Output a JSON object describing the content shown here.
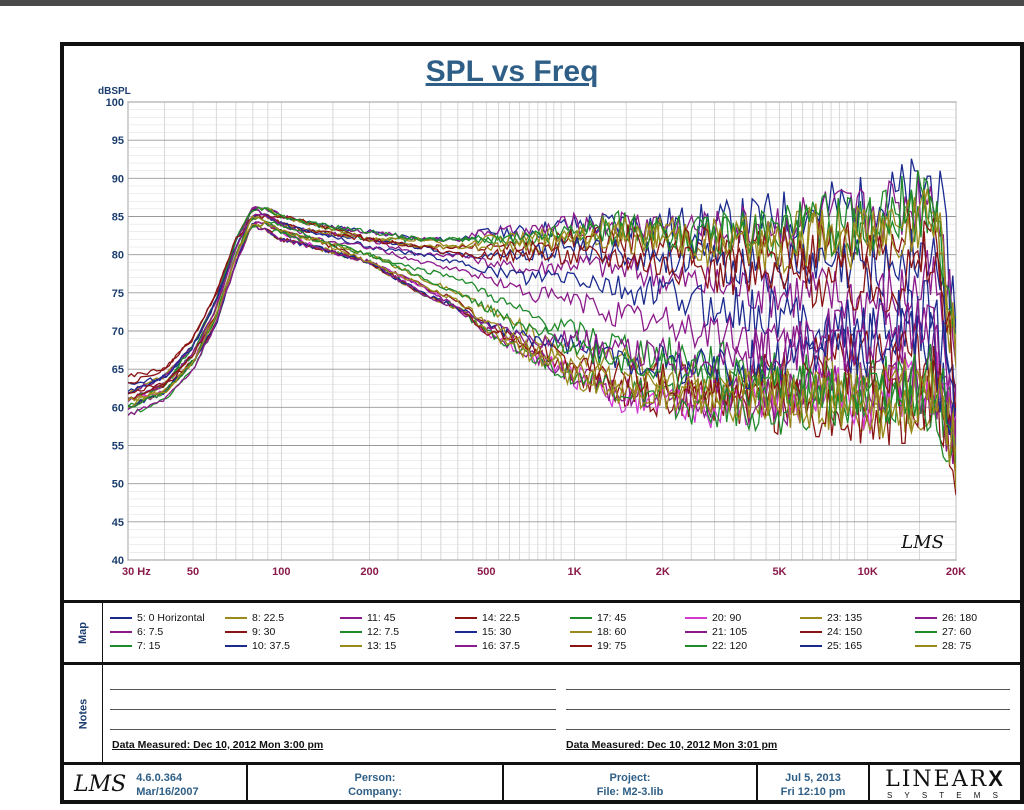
{
  "title": "SPL vs Freq",
  "chart_data": {
    "type": "line",
    "ylabel": "dBSPL",
    "xscale": "log",
    "xlim": [
      30,
      20000
    ],
    "ylim": [
      40,
      100
    ],
    "ytick_labels": [
      "40",
      "45",
      "50",
      "55",
      "60",
      "65",
      "70",
      "75",
      "80",
      "85",
      "90",
      "95",
      "100"
    ],
    "xtick_labels": [
      "30  Hz",
      "50",
      "100",
      "200",
      "500",
      "1K",
      "2K",
      "5K",
      "10K",
      "20K"
    ],
    "grid": true,
    "freq": [
      30,
      40,
      50,
      60,
      70,
      80,
      90,
      100,
      130,
      200,
      300,
      400,
      500,
      700,
      1000,
      1500,
      2000,
      3000,
      5000,
      7000,
      10000,
      14000,
      17000,
      20000
    ],
    "series": [
      {
        "name": "5: 0 Horizontal",
        "color": "#1b2a8e",
        "values": [
          62,
          64,
          68,
          74,
          82,
          86,
          86,
          85,
          84,
          83,
          82,
          82,
          83,
          83,
          84,
          84,
          84,
          84,
          85,
          86,
          86,
          88,
          90,
          72
        ]
      },
      {
        "name": "6: 7.5",
        "color": "#8b1a8b",
        "values": [
          61,
          63,
          67,
          73,
          82,
          86,
          86,
          85,
          84,
          83,
          82,
          82,
          83,
          83,
          84,
          84,
          84,
          83,
          84,
          85,
          85,
          87,
          89,
          70
        ]
      },
      {
        "name": "7: 15",
        "color": "#1f8a2a",
        "values": [
          60,
          63,
          67,
          73,
          81,
          86,
          86,
          85,
          84,
          82,
          82,
          82,
          82,
          82,
          83,
          84,
          83,
          83,
          83,
          84,
          84,
          86,
          88,
          68
        ]
      },
      {
        "name": "8: 22.5",
        "color": "#9a8a1c",
        "values": [
          62,
          64,
          68,
          74,
          82,
          86,
          86,
          85,
          84,
          82,
          82,
          81,
          82,
          82,
          83,
          83,
          83,
          82,
          82,
          83,
          83,
          85,
          86,
          66
        ]
      },
      {
        "name": "9: 30",
        "color": "#8a1414",
        "values": [
          64,
          65,
          69,
          75,
          82,
          86,
          85,
          85,
          84,
          82,
          81,
          81,
          81,
          81,
          82,
          82,
          81,
          81,
          80,
          81,
          81,
          82,
          84,
          63
        ]
      },
      {
        "name": "10: 37.5",
        "color": "#1b2a8e",
        "values": [
          63,
          64,
          68,
          74,
          82,
          86,
          85,
          84,
          83,
          82,
          81,
          80,
          80,
          80,
          81,
          80,
          80,
          79,
          78,
          78,
          78,
          79,
          80,
          60
        ]
      },
      {
        "name": "11: 45",
        "color": "#8b1a8b",
        "values": [
          62,
          64,
          68,
          74,
          82,
          86,
          85,
          84,
          83,
          82,
          80,
          80,
          79,
          78,
          79,
          78,
          77,
          76,
          75,
          75,
          74,
          75,
          76,
          58
        ]
      },
      {
        "name": "12: 7.5",
        "color": "#1f8a2a",
        "values": [
          61,
          63,
          68,
          74,
          82,
          86,
          86,
          85,
          84,
          83,
          82,
          82,
          82,
          82,
          83,
          83,
          83,
          82,
          83,
          84,
          84,
          86,
          88,
          67
        ]
      },
      {
        "name": "13: 15",
        "color": "#9a8a1c",
        "values": [
          60,
          63,
          67,
          73,
          81,
          85,
          85,
          84,
          83,
          82,
          81,
          81,
          81,
          81,
          82,
          82,
          82,
          81,
          81,
          82,
          82,
          84,
          86,
          65
        ]
      },
      {
        "name": "14: 22.5",
        "color": "#8a1414",
        "values": [
          63,
          65,
          69,
          75,
          82,
          85,
          85,
          84,
          83,
          82,
          81,
          80,
          80,
          80,
          80,
          80,
          79,
          78,
          77,
          77,
          76,
          78,
          80,
          62
        ]
      },
      {
        "name": "15: 30",
        "color": "#1b2a8e",
        "values": [
          62,
          64,
          68,
          74,
          81,
          85,
          85,
          84,
          83,
          81,
          80,
          79,
          78,
          77,
          77,
          75,
          75,
          73,
          72,
          71,
          70,
          71,
          73,
          58
        ]
      },
      {
        "name": "16: 37.5",
        "color": "#8b1a8b",
        "values": [
          61,
          63,
          67,
          73,
          81,
          85,
          85,
          84,
          82,
          81,
          79,
          78,
          77,
          75,
          74,
          72,
          71,
          70,
          68,
          67,
          66,
          67,
          69,
          56
        ]
      },
      {
        "name": "17: 45",
        "color": "#1f8a2a",
        "values": [
          60,
          62,
          66,
          72,
          80,
          85,
          84,
          84,
          82,
          80,
          78,
          77,
          75,
          72,
          70,
          68,
          67,
          66,
          64,
          63,
          62,
          63,
          64,
          55
        ]
      },
      {
        "name": "18: 60",
        "color": "#9a8a1c",
        "values": [
          61,
          62,
          66,
          72,
          80,
          85,
          84,
          83,
          82,
          80,
          77,
          75,
          73,
          70,
          67,
          66,
          64,
          63,
          62,
          61,
          60,
          61,
          62,
          54
        ]
      },
      {
        "name": "19: 75",
        "color": "#8a1414",
        "values": [
          62,
          63,
          67,
          72,
          80,
          84,
          84,
          83,
          82,
          79,
          76,
          74,
          71,
          68,
          64,
          62,
          61,
          61,
          60,
          60,
          59,
          60,
          61,
          52
        ]
      },
      {
        "name": "20: 90",
        "color": "#d23ad2",
        "values": [
          61,
          62,
          66,
          72,
          80,
          84,
          84,
          83,
          81,
          79,
          76,
          73,
          70,
          67,
          64,
          61,
          61,
          60,
          61,
          62,
          61,
          62,
          63,
          54
        ]
      },
      {
        "name": "21: 105",
        "color": "#8b1a8b",
        "values": [
          60,
          62,
          66,
          71,
          79,
          84,
          84,
          83,
          81,
          79,
          76,
          73,
          70,
          67,
          64,
          62,
          62,
          61,
          61,
          62,
          62,
          63,
          64,
          55
        ]
      },
      {
        "name": "22: 120",
        "color": "#1f8a2a",
        "values": [
          59,
          61,
          65,
          71,
          79,
          84,
          83,
          83,
          81,
          79,
          75,
          73,
          70,
          67,
          64,
          62,
          61,
          60,
          60,
          61,
          60,
          61,
          62,
          53
        ]
      },
      {
        "name": "23: 135",
        "color": "#9a8a1c",
        "values": [
          60,
          62,
          66,
          71,
          79,
          84,
          83,
          82,
          81,
          79,
          75,
          73,
          70,
          67,
          64,
          62,
          62,
          61,
          62,
          63,
          62,
          63,
          64,
          54
        ]
      },
      {
        "name": "24: 150",
        "color": "#8a1414",
        "values": [
          61,
          63,
          66,
          71,
          79,
          84,
          83,
          82,
          81,
          79,
          75,
          73,
          70,
          68,
          66,
          64,
          64,
          63,
          64,
          66,
          66,
          67,
          66,
          55
        ]
      },
      {
        "name": "25: 165",
        "color": "#1b2a8e",
        "values": [
          60,
          62,
          66,
          71,
          79,
          84,
          83,
          82,
          81,
          79,
          75,
          73,
          71,
          69,
          68,
          66,
          66,
          65,
          66,
          68,
          68,
          69,
          67,
          56
        ]
      },
      {
        "name": "26: 180",
        "color": "#8b1a8b",
        "values": [
          59,
          61,
          65,
          71,
          79,
          84,
          83,
          82,
          81,
          79,
          75,
          73,
          71,
          69,
          69,
          67,
          67,
          66,
          67,
          69,
          69,
          70,
          68,
          57
        ]
      },
      {
        "name": "27: 60",
        "color": "#1f8a2a",
        "values": [
          60,
          62,
          66,
          72,
          80,
          84,
          84,
          83,
          82,
          80,
          77,
          75,
          73,
          70,
          68,
          66,
          65,
          64,
          63,
          62,
          62,
          63,
          64,
          54
        ]
      },
      {
        "name": "28: 75",
        "color": "#9a8a1c",
        "values": [
          61,
          62,
          66,
          72,
          80,
          84,
          84,
          83,
          82,
          79,
          76,
          74,
          71,
          68,
          65,
          63,
          62,
          62,
          61,
          61,
          60,
          61,
          62,
          53
        ]
      }
    ]
  },
  "map_label": "Map",
  "notes_label": "Notes",
  "notes": {
    "measured_left": "Data Measured: Dec 10, 2012  Mon  3:00 pm",
    "measured_right": "Data Measured: Dec 10, 2012  Mon  3:01 pm"
  },
  "watermark": "LMS",
  "footer": {
    "logo": "LMS",
    "version": "4.6.0.364",
    "version_date": "Mar/16/2007",
    "person": "Person:",
    "company": "Company:",
    "project": "Project:",
    "file": "File: M2-3.lib",
    "date": "Jul  5, 2013",
    "time": "Fri 12:10 pm",
    "brand": "LINEAR",
    "brand_x": "X",
    "brand_sub": "S Y S T E M S"
  },
  "colors": {
    "title": "#2f5f86",
    "axis_labels": "#8a1a4a",
    "ylabel": "#1b3d6e",
    "grid": "#c8c8c8"
  }
}
